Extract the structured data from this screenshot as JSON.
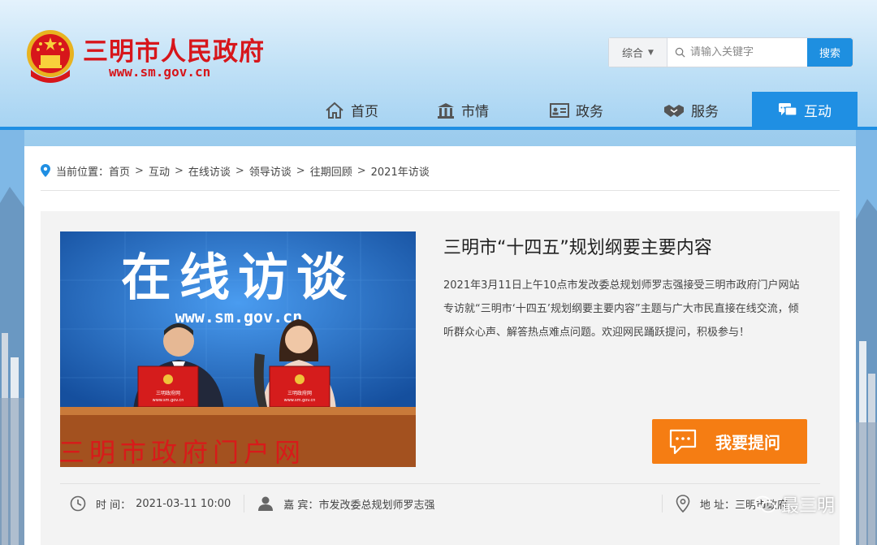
{
  "header": {
    "site_name": "三明市人民政府",
    "site_url": "www.sm.gov.cn",
    "search": {
      "category": "综合",
      "placeholder": "请输入关键字",
      "button": "搜索"
    }
  },
  "nav": {
    "items": [
      {
        "label": "首页",
        "icon": "home-icon"
      },
      {
        "label": "市情",
        "icon": "building-icon"
      },
      {
        "label": "政务",
        "icon": "id-card-icon"
      },
      {
        "label": "服务",
        "icon": "handshake-icon"
      },
      {
        "label": "互动",
        "icon": "chat-icon",
        "active": true
      }
    ]
  },
  "breadcrumb": {
    "prefix": "当前位置：",
    "items": [
      "首页",
      "互动",
      "在线访谈",
      "领导访谈",
      "往期回顾",
      "2021年访谈"
    ]
  },
  "interview": {
    "title": "三明市“十四五”规划纲要主要内容",
    "description": "2021年3月11日上午10点市发改委总规划师罗志强接受三明市政府门户网站专访就“三明市‘十四五’规划纲要主要内容”主题与广大市民直接在线交流，倾听群众心声、解答热点难点问题。欢迎网民踊跃提问，积极参与！",
    "ask_button": "我要提问",
    "photo": {
      "banner": "在线访谈",
      "url": "www.sm.gov.cn",
      "laptop_left": "三明政府网",
      "laptop_left_url": "www.sm.gov.cn",
      "laptop_right": "三明政府网",
      "laptop_right_url": "www.sm.gov.cn",
      "desk_text": "三明市政府门户网"
    },
    "time_label": "时 间：",
    "time_value": "2021-03-11 10:00",
    "guest_label": "嘉 宾：",
    "guest_value": "市发改委总规划师罗志强",
    "address_label": "地 址：",
    "address_value": "三明市政府"
  },
  "watermark": "最三明",
  "colors": {
    "brand_red": "#d7161b",
    "nav_blue": "#1f8fe3",
    "ask_orange": "#f57d13"
  }
}
